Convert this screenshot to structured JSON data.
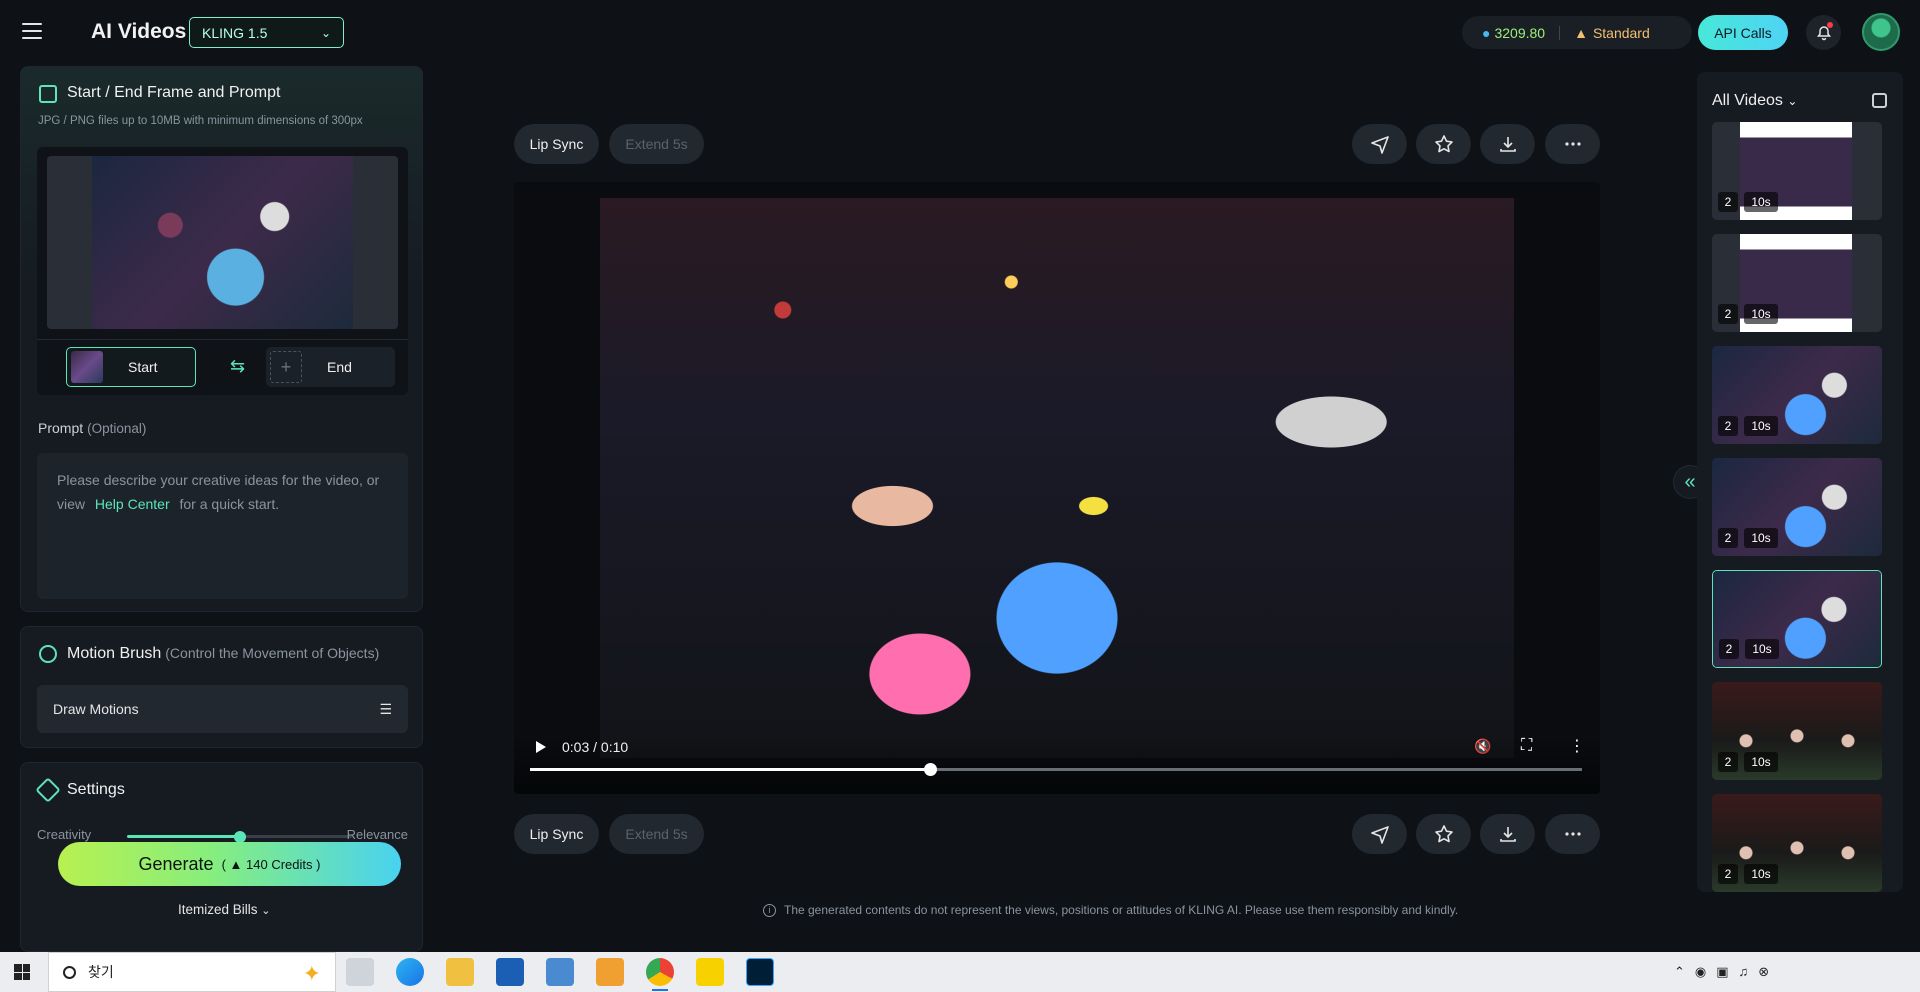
{
  "header": {
    "app_title": "AI Videos",
    "model": "KLING 1.5",
    "credits_value": "3209.80",
    "plan": "Standard",
    "api_label": "API Calls"
  },
  "left": {
    "frame_panel": {
      "title": "Start / End Frame and Prompt",
      "hint": "JPG / PNG files up to 10MB with minimum dimensions of 300px",
      "start_label": "Start",
      "end_label": "End"
    },
    "prompt": {
      "label": "Prompt",
      "optional": "(Optional)",
      "text_before": "Please describe your creative ideas for the video, or view",
      "link": "Help Center",
      "text_after": "for a quick start."
    },
    "motion": {
      "title": "Motion Brush",
      "note": "(Control the Movement of Objects)",
      "draw_label": "Draw Motions"
    },
    "settings": {
      "title": "Settings",
      "creativity": "Creativity",
      "relevance": "Relevance",
      "slider_value": 0.5
    },
    "generate": {
      "label": "Generate",
      "credits": "140 Credits"
    },
    "itemized": "Itemized Bills"
  },
  "center": {
    "lip_sync": "Lip Sync",
    "extend": "Extend 5s",
    "time": "0:03 / 0:10",
    "progress": 0.38,
    "disclaimer": "The generated contents do not represent the views, positions or attitudes of KLING AI. Please use them responsibly and kindly."
  },
  "right": {
    "title": "All Videos",
    "videos": [
      {
        "count": "2",
        "duration": "10s",
        "style": "doc"
      },
      {
        "count": "2",
        "duration": "10s",
        "style": "doc"
      },
      {
        "count": "2",
        "duration": "10s",
        "style": "scene"
      },
      {
        "count": "2",
        "duration": "10s",
        "style": "scene"
      },
      {
        "count": "2",
        "duration": "10s",
        "style": "scene",
        "active": true
      },
      {
        "count": "2",
        "duration": "10s",
        "style": "crowd"
      },
      {
        "count": "2",
        "duration": "10s",
        "style": "crowd"
      }
    ]
  },
  "taskbar": {
    "search_placeholder": "찾기"
  },
  "icons": {
    "accent": "#5ce6b8"
  }
}
